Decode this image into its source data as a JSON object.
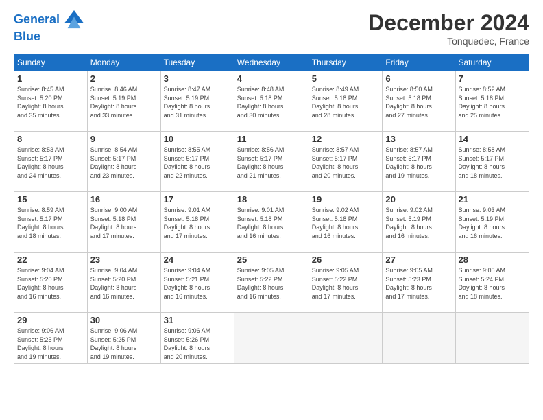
{
  "header": {
    "logo_line1": "General",
    "logo_line2": "Blue",
    "month_title": "December 2024",
    "location": "Tonquedec, France"
  },
  "weekdays": [
    "Sunday",
    "Monday",
    "Tuesday",
    "Wednesday",
    "Thursday",
    "Friday",
    "Saturday"
  ],
  "weeks": [
    [
      {
        "day": "1",
        "info": "Sunrise: 8:45 AM\nSunset: 5:20 PM\nDaylight: 8 hours\nand 35 minutes."
      },
      {
        "day": "2",
        "info": "Sunrise: 8:46 AM\nSunset: 5:19 PM\nDaylight: 8 hours\nand 33 minutes."
      },
      {
        "day": "3",
        "info": "Sunrise: 8:47 AM\nSunset: 5:19 PM\nDaylight: 8 hours\nand 31 minutes."
      },
      {
        "day": "4",
        "info": "Sunrise: 8:48 AM\nSunset: 5:18 PM\nDaylight: 8 hours\nand 30 minutes."
      },
      {
        "day": "5",
        "info": "Sunrise: 8:49 AM\nSunset: 5:18 PM\nDaylight: 8 hours\nand 28 minutes."
      },
      {
        "day": "6",
        "info": "Sunrise: 8:50 AM\nSunset: 5:18 PM\nDaylight: 8 hours\nand 27 minutes."
      },
      {
        "day": "7",
        "info": "Sunrise: 8:52 AM\nSunset: 5:18 PM\nDaylight: 8 hours\nand 25 minutes."
      }
    ],
    [
      {
        "day": "8",
        "info": "Sunrise: 8:53 AM\nSunset: 5:17 PM\nDaylight: 8 hours\nand 24 minutes."
      },
      {
        "day": "9",
        "info": "Sunrise: 8:54 AM\nSunset: 5:17 PM\nDaylight: 8 hours\nand 23 minutes."
      },
      {
        "day": "10",
        "info": "Sunrise: 8:55 AM\nSunset: 5:17 PM\nDaylight: 8 hours\nand 22 minutes."
      },
      {
        "day": "11",
        "info": "Sunrise: 8:56 AM\nSunset: 5:17 PM\nDaylight: 8 hours\nand 21 minutes."
      },
      {
        "day": "12",
        "info": "Sunrise: 8:57 AM\nSunset: 5:17 PM\nDaylight: 8 hours\nand 20 minutes."
      },
      {
        "day": "13",
        "info": "Sunrise: 8:57 AM\nSunset: 5:17 PM\nDaylight: 8 hours\nand 19 minutes."
      },
      {
        "day": "14",
        "info": "Sunrise: 8:58 AM\nSunset: 5:17 PM\nDaylight: 8 hours\nand 18 minutes."
      }
    ],
    [
      {
        "day": "15",
        "info": "Sunrise: 8:59 AM\nSunset: 5:17 PM\nDaylight: 8 hours\nand 18 minutes."
      },
      {
        "day": "16",
        "info": "Sunrise: 9:00 AM\nSunset: 5:18 PM\nDaylight: 8 hours\nand 17 minutes."
      },
      {
        "day": "17",
        "info": "Sunrise: 9:01 AM\nSunset: 5:18 PM\nDaylight: 8 hours\nand 17 minutes."
      },
      {
        "day": "18",
        "info": "Sunrise: 9:01 AM\nSunset: 5:18 PM\nDaylight: 8 hours\nand 16 minutes."
      },
      {
        "day": "19",
        "info": "Sunrise: 9:02 AM\nSunset: 5:18 PM\nDaylight: 8 hours\nand 16 minutes."
      },
      {
        "day": "20",
        "info": "Sunrise: 9:02 AM\nSunset: 5:19 PM\nDaylight: 8 hours\nand 16 minutes."
      },
      {
        "day": "21",
        "info": "Sunrise: 9:03 AM\nSunset: 5:19 PM\nDaylight: 8 hours\nand 16 minutes."
      }
    ],
    [
      {
        "day": "22",
        "info": "Sunrise: 9:04 AM\nSunset: 5:20 PM\nDaylight: 8 hours\nand 16 minutes."
      },
      {
        "day": "23",
        "info": "Sunrise: 9:04 AM\nSunset: 5:20 PM\nDaylight: 8 hours\nand 16 minutes."
      },
      {
        "day": "24",
        "info": "Sunrise: 9:04 AM\nSunset: 5:21 PM\nDaylight: 8 hours\nand 16 minutes."
      },
      {
        "day": "25",
        "info": "Sunrise: 9:05 AM\nSunset: 5:22 PM\nDaylight: 8 hours\nand 16 minutes."
      },
      {
        "day": "26",
        "info": "Sunrise: 9:05 AM\nSunset: 5:22 PM\nDaylight: 8 hours\nand 17 minutes."
      },
      {
        "day": "27",
        "info": "Sunrise: 9:05 AM\nSunset: 5:23 PM\nDaylight: 8 hours\nand 17 minutes."
      },
      {
        "day": "28",
        "info": "Sunrise: 9:05 AM\nSunset: 5:24 PM\nDaylight: 8 hours\nand 18 minutes."
      }
    ],
    [
      {
        "day": "29",
        "info": "Sunrise: 9:06 AM\nSunset: 5:25 PM\nDaylight: 8 hours\nand 19 minutes."
      },
      {
        "day": "30",
        "info": "Sunrise: 9:06 AM\nSunset: 5:25 PM\nDaylight: 8 hours\nand 19 minutes."
      },
      {
        "day": "31",
        "info": "Sunrise: 9:06 AM\nSunset: 5:26 PM\nDaylight: 8 hours\nand 20 minutes."
      },
      null,
      null,
      null,
      null
    ]
  ]
}
